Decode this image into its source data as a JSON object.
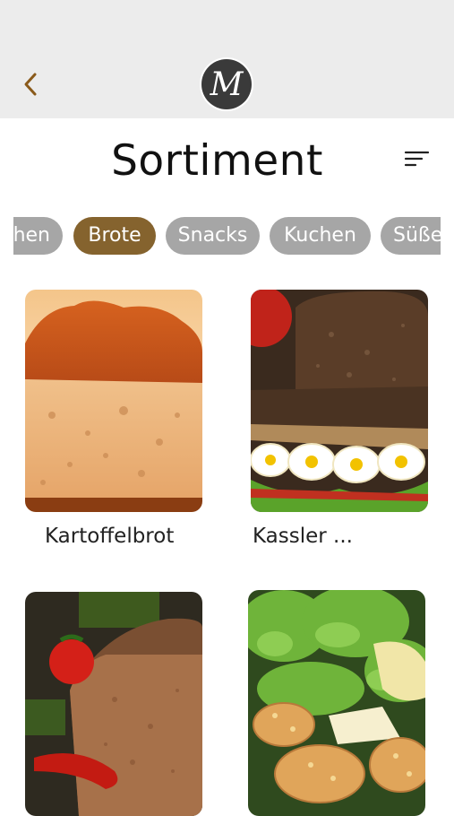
{
  "header": {
    "back_icon": "chevron-left-icon",
    "logo_letter": "M",
    "title": "Sortiment",
    "sort_icon": "sort-lines-icon"
  },
  "colors": {
    "accent": "#85632e",
    "chip": "#a6a6a6",
    "topbar": "#ececec"
  },
  "categories": {
    "selected": "Brote",
    "items": [
      {
        "label": "Kuchen"
      },
      {
        "label": "Brote"
      },
      {
        "label": "Snacks"
      },
      {
        "label": "Kuchen"
      },
      {
        "label": "Süße"
      }
    ]
  },
  "products": [
    {
      "name": "Kartoffelbrot",
      "image": "potato-bread-loaf"
    },
    {
      "name": "Kassler ...",
      "image": "dark-bread-sandwich-egg"
    },
    {
      "name": "",
      "image": "rye-bread-with-tomato-and-pepper"
    },
    {
      "name": "",
      "image": "cheese-pastries-with-lettuce"
    }
  ]
}
